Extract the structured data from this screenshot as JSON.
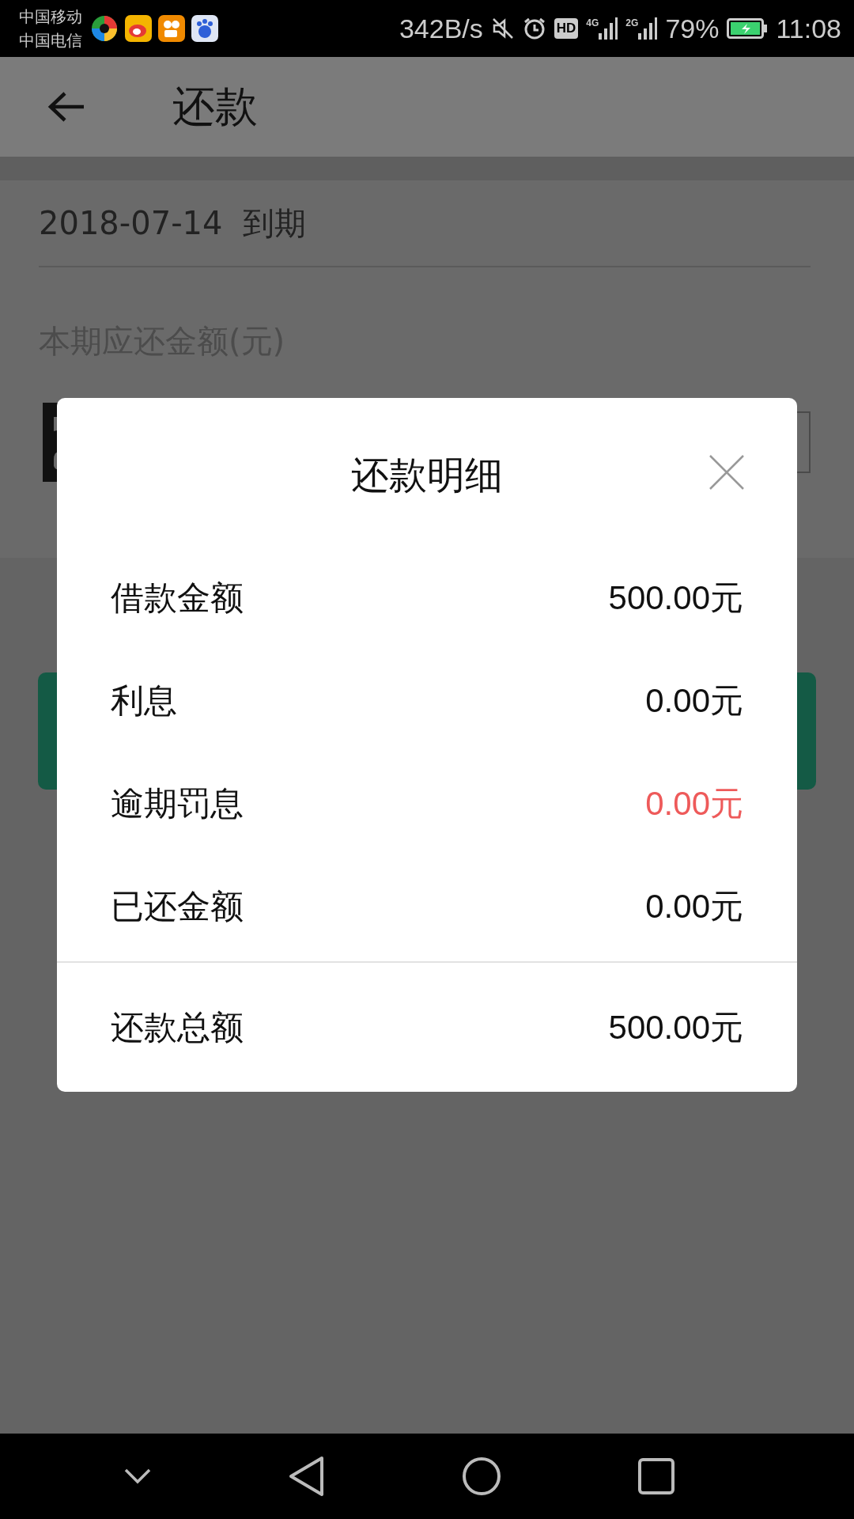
{
  "status_bar": {
    "carriers": [
      "中国移动",
      "中国电信"
    ],
    "speed": "342B/s",
    "badges": [
      "HD"
    ],
    "signals": [
      {
        "network": "4G"
      },
      {
        "network": "2G"
      }
    ],
    "battery": "79%",
    "time": "11:08"
  },
  "app_bar": {
    "title": "还款"
  },
  "due": {
    "date": "2018-07-14",
    "label": "到期"
  },
  "amount": {
    "label": "本期应还金额(元)"
  },
  "dialog": {
    "title": "还款明细",
    "rows": [
      {
        "label": "借款金额",
        "value": "500.00元",
        "highlight": false
      },
      {
        "label": "利息",
        "value": "0.00元",
        "highlight": false
      },
      {
        "label": "逾期罚息",
        "value": "0.00元",
        "highlight": true
      },
      {
        "label": "已还金额",
        "value": "0.00元",
        "highlight": false
      }
    ],
    "total": {
      "label": "还款总额",
      "value": "500.00元"
    }
  }
}
